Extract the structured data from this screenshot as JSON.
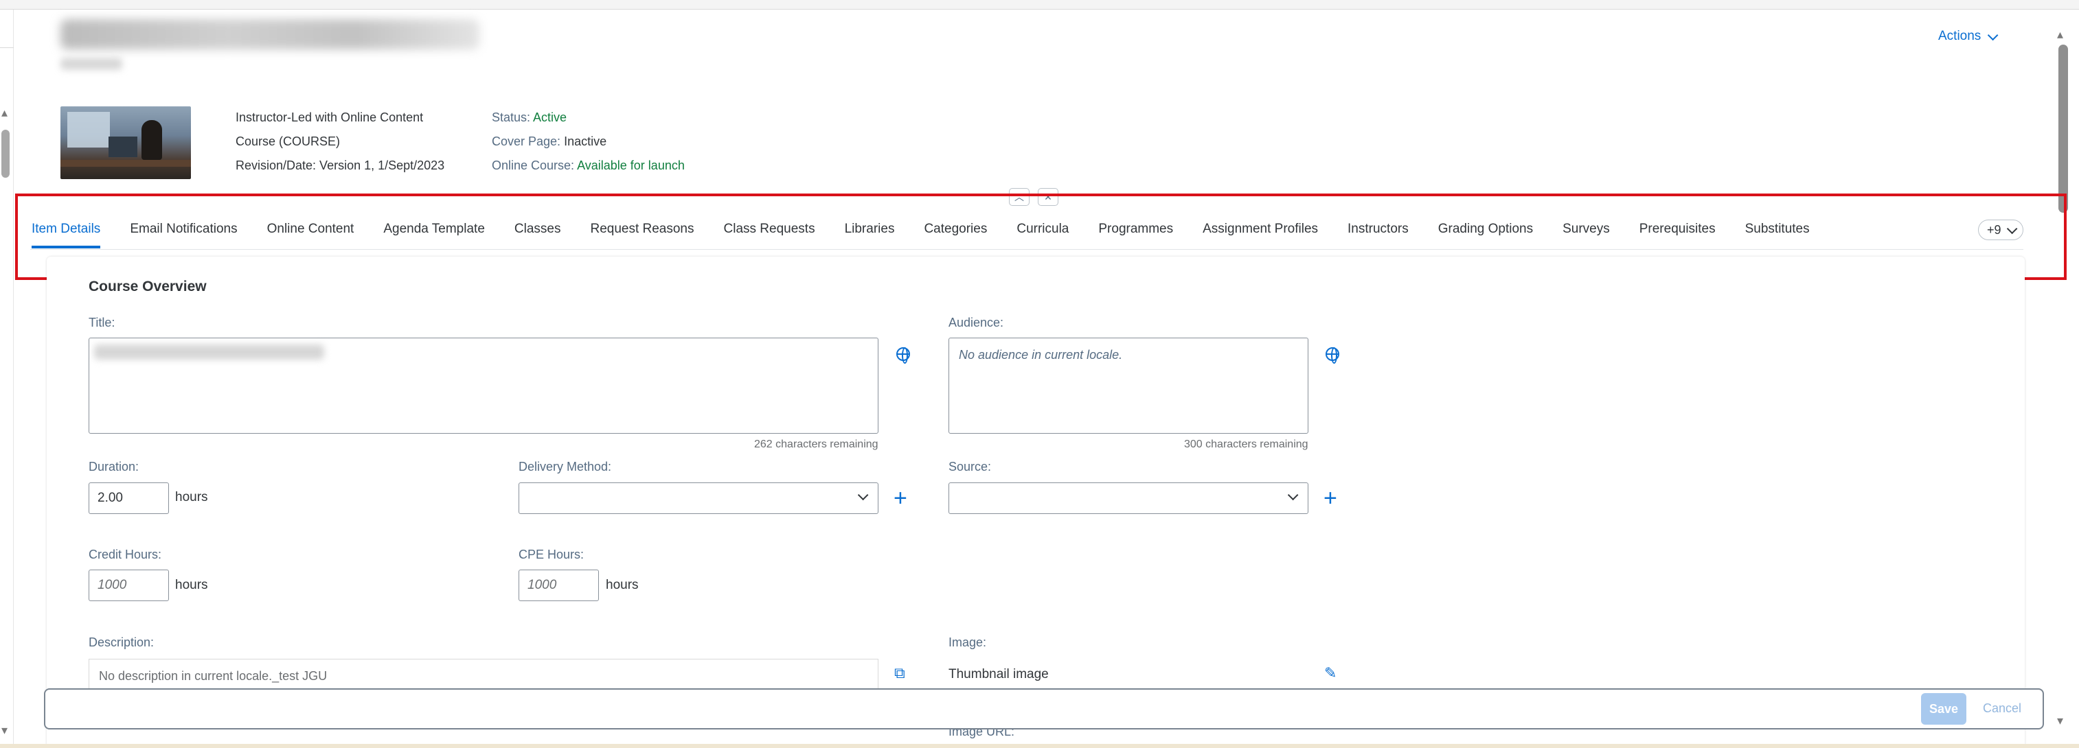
{
  "header": {
    "actions_label": "Actions"
  },
  "meta": {
    "type": "Instructor-Led with Online Content",
    "course_type": "Course (COURSE)",
    "revision": "Revision/Date: Version 1, 1/Sept/2023",
    "status_label": "Status:",
    "status_value": "Active",
    "cover_label": "Cover Page:",
    "cover_value": "Inactive",
    "online_label": "Online Course:",
    "online_value": "Available for launch"
  },
  "tabs": [
    {
      "label": "Item Details",
      "active": true
    },
    {
      "label": "Email Notifications"
    },
    {
      "label": "Online Content"
    },
    {
      "label": "Agenda Template"
    },
    {
      "label": "Classes"
    },
    {
      "label": "Request Reasons"
    },
    {
      "label": "Class Requests"
    },
    {
      "label": "Libraries"
    },
    {
      "label": "Categories"
    },
    {
      "label": "Curricula"
    },
    {
      "label": "Programmes"
    },
    {
      "label": "Assignment Profiles"
    },
    {
      "label": "Instructors"
    },
    {
      "label": "Grading Options"
    },
    {
      "label": "Surveys"
    },
    {
      "label": "Prerequisites"
    },
    {
      "label": "Substitutes"
    }
  ],
  "more_tabs_label": "+9",
  "form": {
    "section_title": "Course Overview",
    "title_label": "Title:",
    "title_counter": "262 characters remaining",
    "audience_label": "Audience:",
    "audience_placeholder": "No audience in current locale.",
    "audience_counter": "300 characters remaining",
    "duration_label": "Duration:",
    "duration_value": "2.00",
    "hours": "hours",
    "delivery_label": "Delivery Method:",
    "source_label": "Source:",
    "credit_label": "Credit Hours:",
    "credit_placeholder": "1000",
    "cpe_label": "CPE Hours:",
    "cpe_placeholder": "1000",
    "description_label": "Description:",
    "description_value": "No description in current locale._test JGU",
    "image_label": "Image:",
    "thumbnail_label": "Thumbnail image",
    "image_url_label": "Image URL:"
  },
  "footer": {
    "save_label": "Save",
    "cancel_label": "Cancel"
  },
  "colors": {
    "accent": "#0a6ed1",
    "positive": "#107e3e",
    "highlight_border": "#d9121a"
  }
}
